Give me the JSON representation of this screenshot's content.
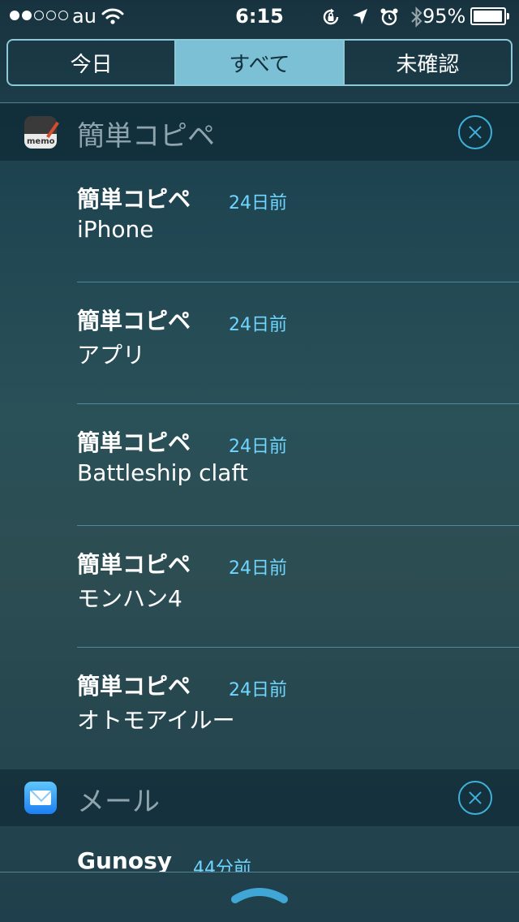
{
  "status_bar": {
    "carrier": "au",
    "time": "6:15",
    "battery_percent": "95%",
    "battery_level": 0.95,
    "signal_bars_filled": 2,
    "signal_bars_total": 5,
    "icons": [
      "wifi-icon",
      "orientation-lock-icon",
      "location-arrow-icon",
      "alarm-icon",
      "bluetooth-icon",
      "battery-icon"
    ]
  },
  "tabs": [
    {
      "label": "今日",
      "active": false
    },
    {
      "label": "すべて",
      "active": true
    },
    {
      "label": "未確認",
      "active": false
    }
  ],
  "sections": [
    {
      "app_name": "簡単コピペ",
      "icon": "memo-app-icon",
      "icon_label": "memo",
      "notifications": [
        {
          "title": "簡単コピペ",
          "time": "24日前",
          "body": "iPhone"
        },
        {
          "title": "簡単コピペ",
          "time": "24日前",
          "body": "アプリ"
        },
        {
          "title": "簡単コピペ",
          "time": "24日前",
          "body": "Battleship claft"
        },
        {
          "title": "簡単コピペ",
          "time": "24日前",
          "body": "モンハン4"
        },
        {
          "title": "簡単コピペ",
          "time": "24日前",
          "body": "オトモアイルー"
        }
      ]
    },
    {
      "app_name": "メール",
      "icon": "mail-app-icon",
      "notifications": [
        {
          "title": "Gunosy",
          "time": "44分前",
          "body": ""
        }
      ]
    }
  ],
  "colors": {
    "accent": "#3fb0d8",
    "time_text": "#6fd6ff",
    "tab_active_bg": "#7cc0d6"
  }
}
